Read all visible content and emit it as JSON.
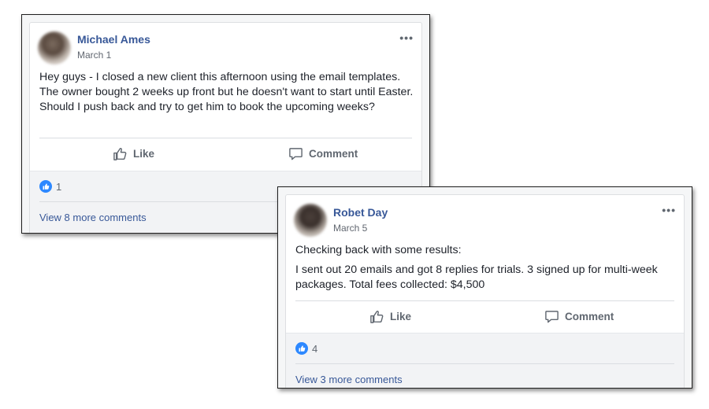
{
  "posts": [
    {
      "author": "Michael Ames",
      "date": "March 1",
      "paragraphs": [
        "Hey guys - I closed a new client this afternoon using the email templates. The owner bought 2 weeks up front but he doesn't want to start until Easter. Should I push back and try to get him to book the upcoming weeks?"
      ],
      "like_label": "Like",
      "comment_label": "Comment",
      "reaction_count": "1",
      "more_comments": "View 8 more comments",
      "menu": "•••"
    },
    {
      "author": "Robet Day",
      "date": "March 5",
      "paragraphs": [
        "Checking back with some results:",
        "I sent out 20 emails and got 8 replies for trials. 3 signed up for multi-week packages. Total fees collected: $4,500"
      ],
      "like_label": "Like",
      "comment_label": "Comment",
      "reaction_count": "4",
      "more_comments": "View 3 more comments",
      "menu": "•••"
    }
  ],
  "colors": {
    "link": "#385898",
    "like_badge": "#2d88ff",
    "muted": "#606770"
  }
}
